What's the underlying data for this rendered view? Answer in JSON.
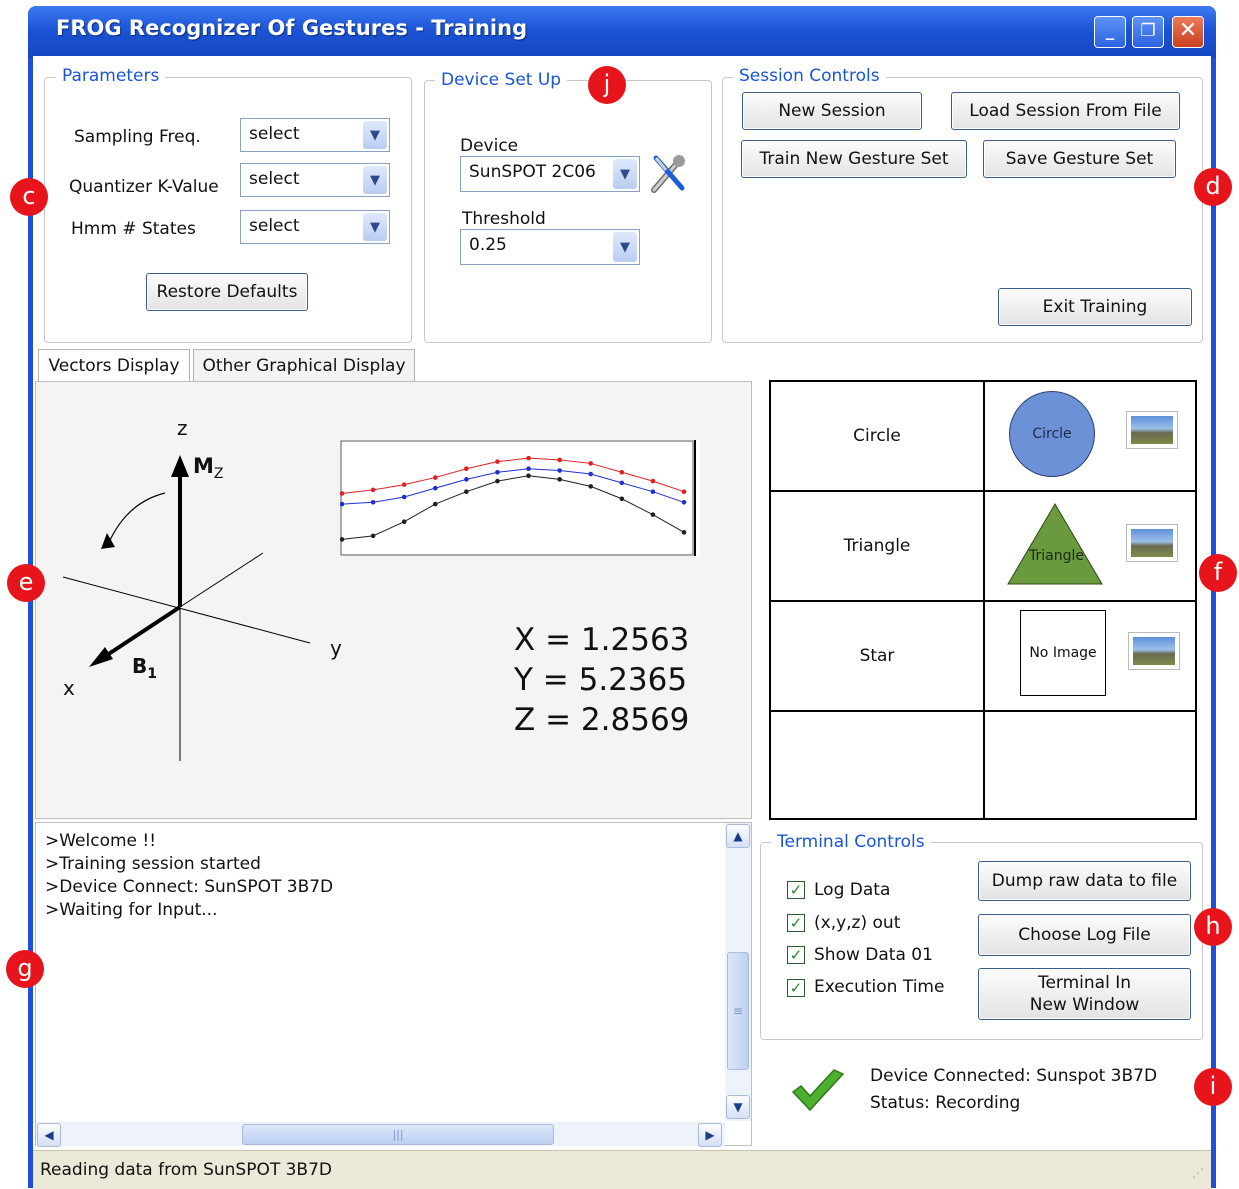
{
  "window": {
    "title": "FROG Recognizer Of Gestures - Training",
    "controls": {
      "minimize": "_",
      "maximize": "❐",
      "close": "✕"
    }
  },
  "markers": {
    "c": "c",
    "d": "d",
    "e": "e",
    "f": "f",
    "g": "g",
    "h": "h",
    "i": "i",
    "j": "j"
  },
  "parameters": {
    "group_label": "Parameters",
    "sampling_label": "Sampling Freq.",
    "sampling_value": "select",
    "quantizer_label": "Quantizer K-Value",
    "quantizer_value": "select",
    "hmm_label": "Hmm # States",
    "hmm_value": "select",
    "restore_label": "Restore Defaults"
  },
  "device_setup": {
    "group_label": "Device Set Up",
    "device_label": "Device",
    "device_value": "SunSPOT 2C06",
    "threshold_label": "Threshold",
    "threshold_value": "0.25"
  },
  "session_controls": {
    "group_label": "Session Controls",
    "new_session": "New Session",
    "load_session": "Load Session From File",
    "train_new": "Train New Gesture Set",
    "save_set": "Save Gesture Set",
    "exit_training": "Exit Training"
  },
  "tabs": [
    "Vectors Display",
    "Other Graphical Display"
  ],
  "vectors": {
    "axis_z": "z",
    "axis_y": "y",
    "axis_x": "x",
    "vec_mz": "M",
    "vec_mz_sub": "Z",
    "vec_b1": "B",
    "vec_b1_sub": "1",
    "x_readout": "X = 1.2563",
    "y_readout": "Y = 5.2365",
    "z_readout": "Z = 2.8569"
  },
  "chart_data": {
    "type": "line",
    "x": [
      0,
      1,
      2,
      3,
      4,
      5,
      6,
      7,
      8,
      9,
      10,
      11
    ],
    "series": [
      {
        "color": "#e02020",
        "values": [
          3.2,
          3.4,
          3.7,
          4.1,
          4.6,
          5.0,
          5.2,
          5.1,
          4.9,
          4.4,
          3.9,
          3.3
        ]
      },
      {
        "color": "#2030d0",
        "values": [
          2.6,
          2.7,
          3.0,
          3.5,
          4.0,
          4.4,
          4.6,
          4.5,
          4.3,
          3.8,
          3.3,
          2.7
        ]
      },
      {
        "color": "#202020",
        "values": [
          0.6,
          0.8,
          1.6,
          2.6,
          3.3,
          3.9,
          4.2,
          4.0,
          3.6,
          2.9,
          2.0,
          1.0
        ]
      }
    ],
    "ylim": [
      0,
      6
    ],
    "grid": false,
    "title": "",
    "xlabel": "",
    "ylabel": ""
  },
  "gestures": [
    {
      "name": "Circle",
      "shape": "circle",
      "shape_label": "Circle"
    },
    {
      "name": "Triangle",
      "shape": "triangle",
      "shape_label": "Triangle"
    },
    {
      "name": "Star",
      "shape": "none",
      "shape_label": "No Image"
    }
  ],
  "console": {
    "lines": [
      ">Welcome  !!",
      ">Training session started",
      ">Device Connect: SunSPOT 3B7D",
      ">Waiting for Input..."
    ]
  },
  "terminal_controls": {
    "group_label": "Terminal Controls",
    "log_data": "Log Data",
    "xyz_out": "(x,y,z) out",
    "show_data": "Show Data 01",
    "exec_time": "Execution Time",
    "checks": [
      true,
      true,
      true,
      true
    ],
    "dump_raw": "Dump raw data to file",
    "choose_log": "Choose Log File",
    "terminal_line1": "Terminal In",
    "terminal_line2": "New Window"
  },
  "status": {
    "device_connected": "Device Connected: Sunspot 3B7D",
    "status_text": "Status: Recording",
    "bar_text": "Reading data from SunSPOT 3B7D"
  }
}
